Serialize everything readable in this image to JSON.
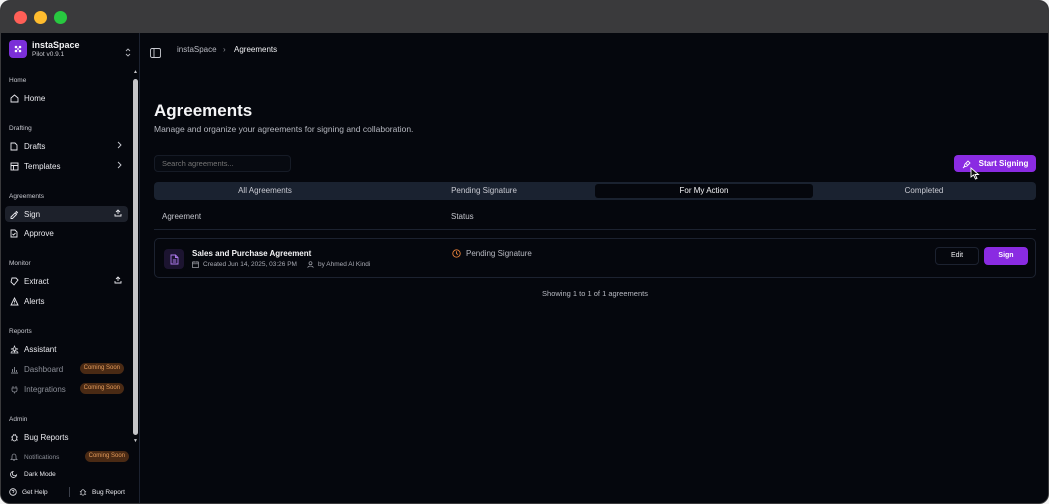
{
  "app": {
    "name": "instaSpace",
    "version": "Pilot v0.9.1"
  },
  "sidebar": {
    "sections": {
      "home": "Home",
      "drafting": "Drafting",
      "agreements": "Agreements",
      "monitor": "Monitor",
      "reports": "Reports",
      "admin": "Admin"
    },
    "items": {
      "home": "Home",
      "drafts": "Drafts",
      "templates": "Templates",
      "sign": "Sign",
      "approve": "Approve",
      "extract": "Extract",
      "alerts": "Alerts",
      "assistant": "Assistant",
      "dashboard": "Dashboard",
      "integrations": "Integrations",
      "bug_reports": "Bug Reports",
      "notifications": "Notifications",
      "dark_mode": "Dark Mode"
    },
    "coming_soon": "Coming Soon",
    "footer": {
      "get_help": "Get Help",
      "bug_report": "Bug Report"
    }
  },
  "breadcrumb": {
    "root": "instaSpace",
    "separator": "›",
    "current": "Agreements"
  },
  "page": {
    "title": "Agreements",
    "subtitle": "Manage and organize your agreements for signing and collaboration.",
    "search_placeholder": "Search agreements...",
    "start_signing": "Start Signing"
  },
  "tabs": [
    "All Agreements",
    "Pending Signature",
    "For My Action",
    "Completed"
  ],
  "active_tab": "For My Action",
  "table": {
    "headers": {
      "agreement": "Agreement",
      "status": "Status"
    },
    "rows": [
      {
        "title": "Sales and Purchase Agreement",
        "created": "Created Jun 14, 2025, 03:26 PM",
        "author": "by Ahmed Al Kindi",
        "status": "Pending Signature",
        "edit": "Edit",
        "sign": "Sign"
      }
    ]
  },
  "showing": "Showing 1 to 1 of 1 agreements",
  "colors": {
    "accent": "#8a2be2",
    "background": "#05070d",
    "status_pending": "#e8823a",
    "coming_soon_bg": "#4a2a14"
  }
}
